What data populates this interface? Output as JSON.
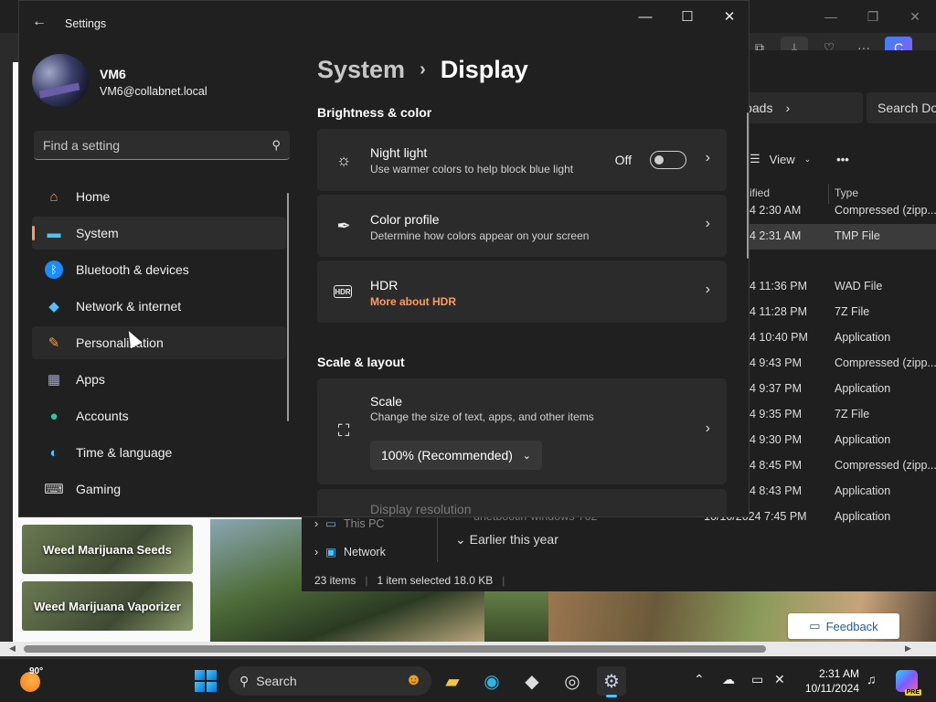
{
  "browser": {
    "minimize": "—",
    "restore": "❐",
    "close": "✕",
    "toolbar_icons": [
      "⧉",
      "⤓",
      "♡",
      "···",
      "C"
    ]
  },
  "web": {
    "tile1": "Weed Marijuana Seeds",
    "tile2": "Weed Marijuana Vaporizer",
    "feedback_label": "Feedback"
  },
  "explorer": {
    "breadcrumb": "loads",
    "search_placeholder": "Search Do",
    "view_label": "View",
    "more": "•••",
    "col_modified": "ified",
    "col_type": "Type",
    "rows": [
      {
        "date": "4 2:30 AM",
        "type": "Compressed (zipp..."
      },
      {
        "date": "4 2:31 AM",
        "type": "TMP File"
      },
      {
        "date": "4 11:36 PM",
        "type": "WAD File"
      },
      {
        "date": "4 11:28 PM",
        "type": "7Z File"
      },
      {
        "date": "4 10:40 PM",
        "type": "Application"
      },
      {
        "date": "4 9:43 PM",
        "type": "Compressed (zipp..."
      },
      {
        "date": "4 9:37 PM",
        "type": "Application"
      },
      {
        "date": "4 9:35 PM",
        "type": "7Z File"
      },
      {
        "date": "4 9:30 PM",
        "type": "Application"
      },
      {
        "date": "4 8:45 PM",
        "type": "Compressed (zipp..."
      },
      {
        "date": "4 8:43 PM",
        "type": "Application"
      },
      {
        "date": "10/10/2024 7:45 PM",
        "type": "Application"
      }
    ],
    "partial_row_name": "unetbootin-windows-702",
    "nav_this_pc": "This PC",
    "nav_network": "Network",
    "group_label": "Earlier this year",
    "status_items": "23 items",
    "status_selected": "1 item selected  18.0 KB"
  },
  "settings": {
    "window_title": "Settings",
    "user_name": "VM6",
    "user_email": "VM6@collabnet.local",
    "search_placeholder": "Find a setting",
    "nav": [
      {
        "label": "Home",
        "icon": "⌂"
      },
      {
        "label": "System",
        "icon": "▬"
      },
      {
        "label": "Bluetooth & devices",
        "icon": "ᛒ"
      },
      {
        "label": "Network & internet",
        "icon": "◆"
      },
      {
        "label": "Personalization",
        "icon": "✎"
      },
      {
        "label": "Apps",
        "icon": "▦"
      },
      {
        "label": "Accounts",
        "icon": "●"
      },
      {
        "label": "Time & language",
        "icon": "◐"
      },
      {
        "label": "Gaming",
        "icon": "⌨"
      }
    ],
    "breadcrumb_parent": "System",
    "breadcrumb_sep": "›",
    "breadcrumb_current": "Display",
    "section_brightness": "Brightness & color",
    "night_light_title": "Night light",
    "night_light_sub": "Use warmer colors to help block blue light",
    "night_light_state": "Off",
    "color_profile_title": "Color profile",
    "color_profile_sub": "Determine how colors appear on your screen",
    "hdr_title": "HDR",
    "hdr_link": "More about HDR",
    "hdr_icon_text": "HDR",
    "section_scale": "Scale & layout",
    "scale_title": "Scale",
    "scale_sub": "Change the size of text, apps, and other items",
    "scale_value": "100% (Recommended)",
    "resolution_title": "Display resolution"
  },
  "taskbar": {
    "temperature": "90°",
    "search_label": "Search",
    "time": "2:31 AM",
    "date": "10/11/2024",
    "pre_badge": "PRE"
  },
  "colors": {
    "accent": "#ff9a62",
    "link": "#ff9a62",
    "taskbar_indicator": "#4cc2ff"
  }
}
